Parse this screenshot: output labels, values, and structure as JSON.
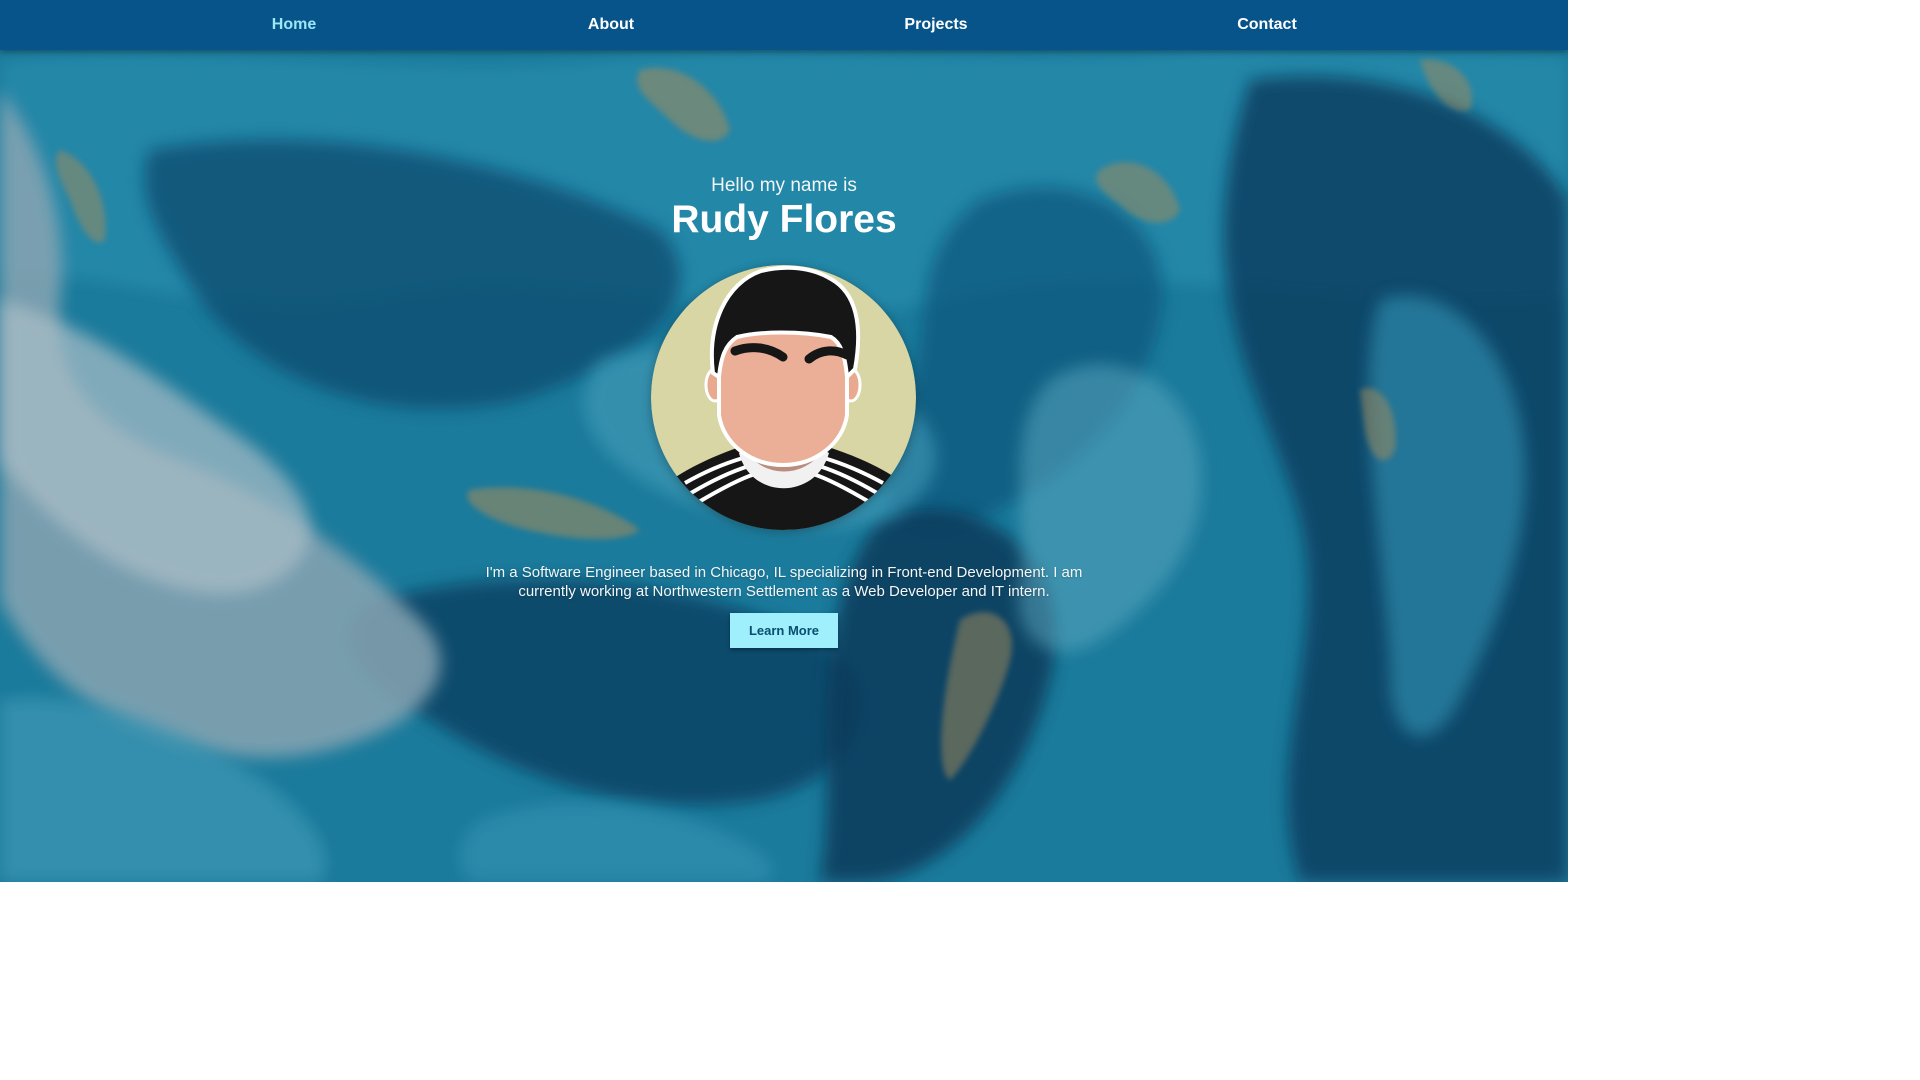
{
  "nav": {
    "items": [
      {
        "label": "Home",
        "active": true
      },
      {
        "label": "About",
        "active": false
      },
      {
        "label": "Projects",
        "active": false
      },
      {
        "label": "Contact",
        "active": false
      }
    ]
  },
  "hero": {
    "greeting": "Hello my name is",
    "name": "Rudy Flores",
    "avatar_icon": "cartoon-portrait-icon",
    "bio": "I'm a Software Engineer based in Chicago, IL specializing in Front-end Development. I am currently working at Northwestern Settlement as a Web Developer and IT intern.",
    "cta_label": "Learn More"
  },
  "colors": {
    "navbar": "#07548a",
    "nav_active": "#9be6f7",
    "button_bg": "#9feffc",
    "button_text": "#0a4d6e"
  }
}
